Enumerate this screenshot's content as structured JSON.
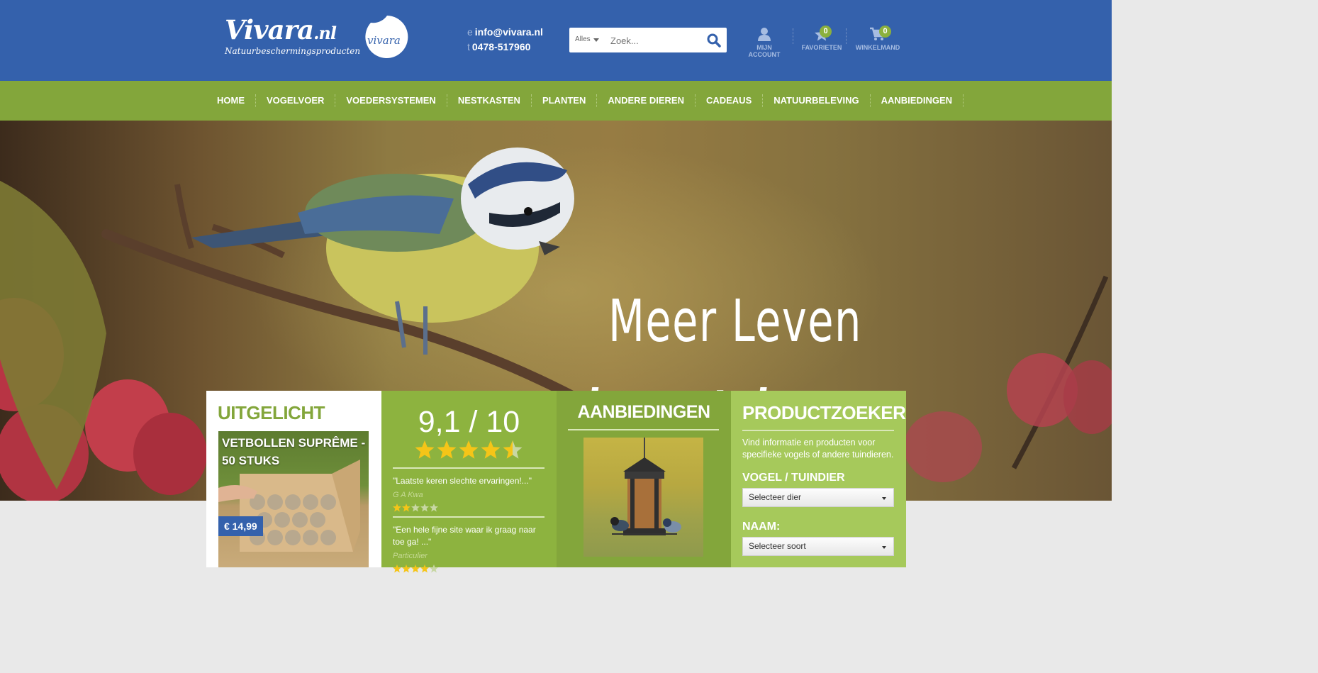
{
  "header": {
    "logo_main": "Vivara",
    "logo_suffix": ".nl",
    "logo_tagline": "Natuurbeschermingsproducten",
    "badge_logo_text": "vivara",
    "email_label": "e",
    "email": "info@vivara.nl",
    "phone_label": "t",
    "phone": "0478-517960",
    "search": {
      "category": "Alles",
      "placeholder": "Zoek..."
    },
    "account_label": "MIJN ACCOUNT",
    "favorites_label": "FAVORIETEN",
    "favorites_count": "0",
    "cart_label": "WINKELMAND",
    "cart_count": "0"
  },
  "nav": [
    "HOME",
    "VOGELVOER",
    "VOEDERSYSTEMEN",
    "NESTKASTEN",
    "PLANTEN",
    "ANDERE DIEREN",
    "CADEAUS",
    "NATUURBELEVING",
    "AANBIEDINGEN"
  ],
  "hero": {
    "line1": "Meer Leven",
    "line2": "in uw tuin"
  },
  "featured": {
    "title": "UITGELICHT",
    "product_name": "VETBOLLEN SUPRÊME - 50 STUKS",
    "price": "€ 14,99"
  },
  "reviews": {
    "score": "9,1 / 10",
    "score_stars": 4.5,
    "items": [
      {
        "text": "\"Laatste keren slechte ervaringen!...\"",
        "author": "G A Kwa",
        "stars": 2
      },
      {
        "text": "\"Een hele fijne site waar ik graag naar toe ga! ...\"",
        "author": "Particulier",
        "stars": 4
      }
    ]
  },
  "offers": {
    "title": "AANBIEDINGEN"
  },
  "finder": {
    "title": "PRODUCTZOEKER",
    "description": "Vind informatie en producten voor specifieke vogels of andere tuindieren.",
    "animal_label": "VOGEL / TUINDIER",
    "animal_select": "Selecteer dier",
    "name_label": "NAAM:",
    "name_select": "Selecteer soort"
  },
  "colors": {
    "header_blue": "#3461ac",
    "nav_green": "#83a63b",
    "badge_green": "#8bb03d",
    "star_gold": "#f5c518"
  }
}
